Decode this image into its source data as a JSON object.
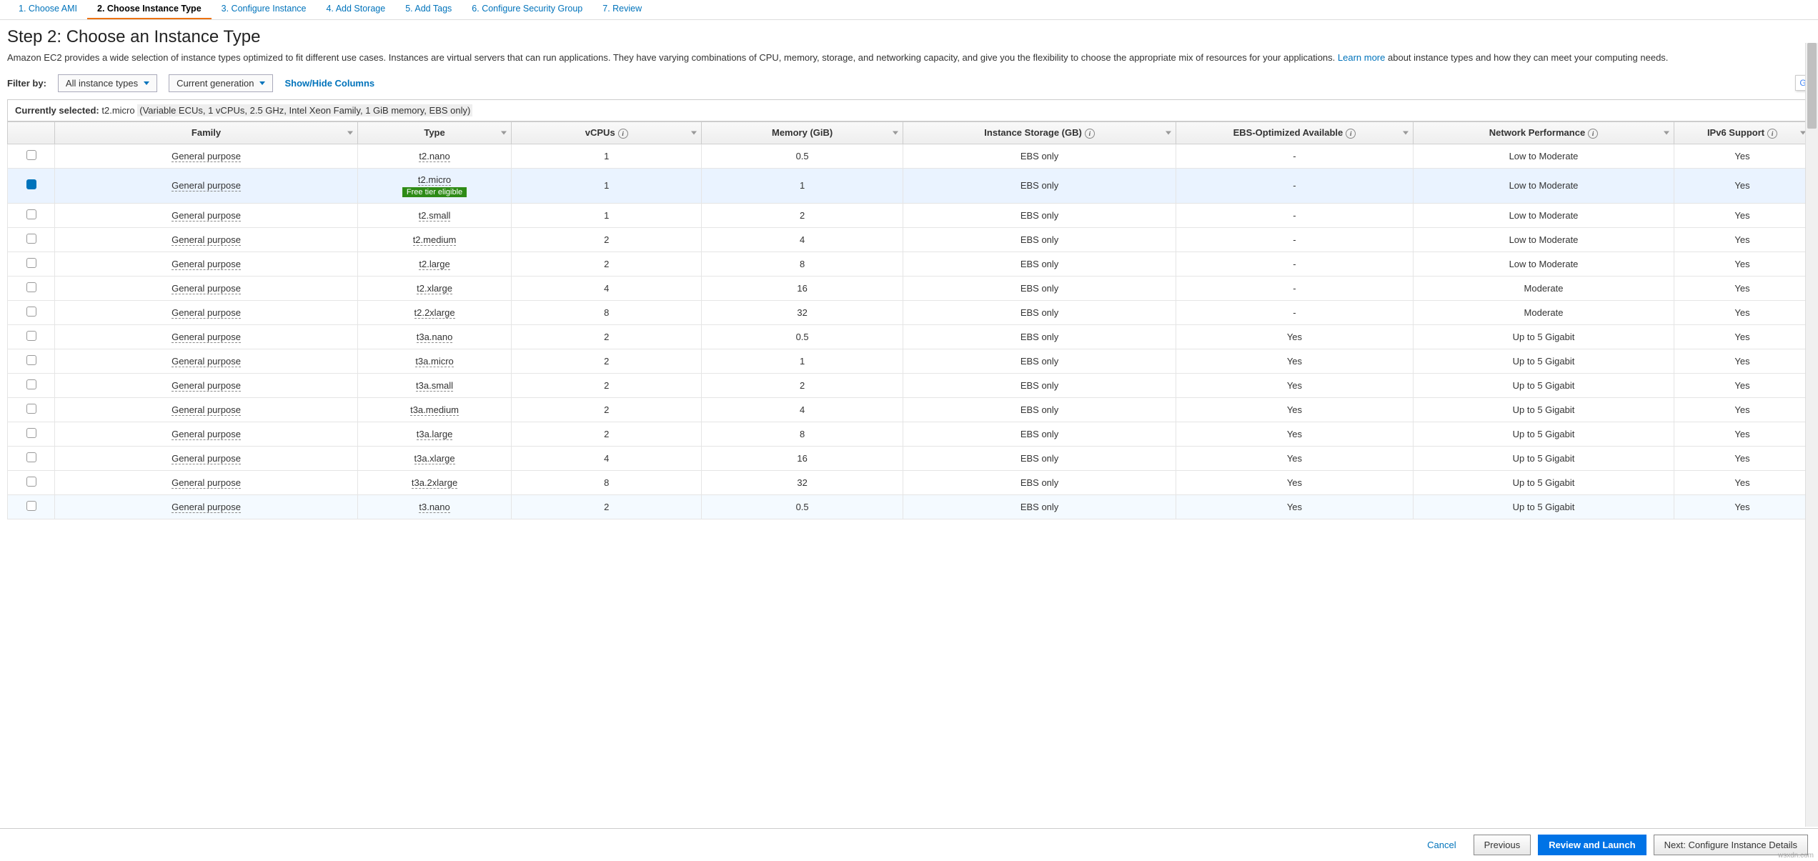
{
  "wizard_tabs": [
    {
      "label": "1. Choose AMI",
      "active": false
    },
    {
      "label": "2. Choose Instance Type",
      "active": true
    },
    {
      "label": "3. Configure Instance",
      "active": false
    },
    {
      "label": "4. Add Storage",
      "active": false
    },
    {
      "label": "5. Add Tags",
      "active": false
    },
    {
      "label": "6. Configure Security Group",
      "active": false
    },
    {
      "label": "7. Review",
      "active": false
    }
  ],
  "heading": "Step 2: Choose an Instance Type",
  "description_pre": "Amazon EC2 provides a wide selection of instance types optimized to fit different use cases. Instances are virtual servers that can run applications. They have varying combinations of CPU, memory, storage, and networking capacity, and give you the flexibility to choose the appropriate mix of resources for your applications.",
  "learn_more_label": "Learn more",
  "description_post": "about instance types and how they can meet your computing needs.",
  "filter": {
    "label": "Filter by:",
    "all_types_label": "All instance types",
    "generation_label": "Current generation",
    "show_hide_label": "Show/Hide Columns"
  },
  "currently_selected": {
    "label": "Currently selected:",
    "value": "t2.micro",
    "details": "(Variable ECUs, 1 vCPUs, 2.5 GHz, Intel Xeon Family, 1 GiB memory, EBS only)"
  },
  "columns": {
    "family": "Family",
    "type": "Type",
    "vcpus": "vCPUs",
    "memory": "Memory (GiB)",
    "storage": "Instance Storage (GB)",
    "ebs": "EBS-Optimized Available",
    "network": "Network Performance",
    "ipv6": "IPv6 Support"
  },
  "free_tier_label": "Free tier eligible",
  "rows": [
    {
      "selected": false,
      "family": "General purpose",
      "type": "t2.nano",
      "free": false,
      "vcpus": "1",
      "memory": "0.5",
      "storage": "EBS only",
      "ebs": "-",
      "network": "Low to Moderate",
      "ipv6": "Yes"
    },
    {
      "selected": true,
      "family": "General purpose",
      "type": "t2.micro",
      "free": true,
      "vcpus": "1",
      "memory": "1",
      "storage": "EBS only",
      "ebs": "-",
      "network": "Low to Moderate",
      "ipv6": "Yes"
    },
    {
      "selected": false,
      "family": "General purpose",
      "type": "t2.small",
      "free": false,
      "vcpus": "1",
      "memory": "2",
      "storage": "EBS only",
      "ebs": "-",
      "network": "Low to Moderate",
      "ipv6": "Yes"
    },
    {
      "selected": false,
      "family": "General purpose",
      "type": "t2.medium",
      "free": false,
      "vcpus": "2",
      "memory": "4",
      "storage": "EBS only",
      "ebs": "-",
      "network": "Low to Moderate",
      "ipv6": "Yes"
    },
    {
      "selected": false,
      "family": "General purpose",
      "type": "t2.large",
      "free": false,
      "vcpus": "2",
      "memory": "8",
      "storage": "EBS only",
      "ebs": "-",
      "network": "Low to Moderate",
      "ipv6": "Yes"
    },
    {
      "selected": false,
      "family": "General purpose",
      "type": "t2.xlarge",
      "free": false,
      "vcpus": "4",
      "memory": "16",
      "storage": "EBS only",
      "ebs": "-",
      "network": "Moderate",
      "ipv6": "Yes"
    },
    {
      "selected": false,
      "family": "General purpose",
      "type": "t2.2xlarge",
      "free": false,
      "vcpus": "8",
      "memory": "32",
      "storage": "EBS only",
      "ebs": "-",
      "network": "Moderate",
      "ipv6": "Yes"
    },
    {
      "selected": false,
      "family": "General purpose",
      "type": "t3a.nano",
      "free": false,
      "vcpus": "2",
      "memory": "0.5",
      "storage": "EBS only",
      "ebs": "Yes",
      "network": "Up to 5 Gigabit",
      "ipv6": "Yes"
    },
    {
      "selected": false,
      "family": "General purpose",
      "type": "t3a.micro",
      "free": false,
      "vcpus": "2",
      "memory": "1",
      "storage": "EBS only",
      "ebs": "Yes",
      "network": "Up to 5 Gigabit",
      "ipv6": "Yes"
    },
    {
      "selected": false,
      "family": "General purpose",
      "type": "t3a.small",
      "free": false,
      "vcpus": "2",
      "memory": "2",
      "storage": "EBS only",
      "ebs": "Yes",
      "network": "Up to 5 Gigabit",
      "ipv6": "Yes"
    },
    {
      "selected": false,
      "family": "General purpose",
      "type": "t3a.medium",
      "free": false,
      "vcpus": "2",
      "memory": "4",
      "storage": "EBS only",
      "ebs": "Yes",
      "network": "Up to 5 Gigabit",
      "ipv6": "Yes"
    },
    {
      "selected": false,
      "family": "General purpose",
      "type": "t3a.large",
      "free": false,
      "vcpus": "2",
      "memory": "8",
      "storage": "EBS only",
      "ebs": "Yes",
      "network": "Up to 5 Gigabit",
      "ipv6": "Yes"
    },
    {
      "selected": false,
      "family": "General purpose",
      "type": "t3a.xlarge",
      "free": false,
      "vcpus": "4",
      "memory": "16",
      "storage": "EBS only",
      "ebs": "Yes",
      "network": "Up to 5 Gigabit",
      "ipv6": "Yes"
    },
    {
      "selected": false,
      "family": "General purpose",
      "type": "t3a.2xlarge",
      "free": false,
      "vcpus": "8",
      "memory": "32",
      "storage": "EBS only",
      "ebs": "Yes",
      "network": "Up to 5 Gigabit",
      "ipv6": "Yes"
    },
    {
      "selected": false,
      "hover": true,
      "family": "General purpose",
      "type": "t3.nano",
      "free": false,
      "vcpus": "2",
      "memory": "0.5",
      "storage": "EBS only",
      "ebs": "Yes",
      "network": "Up to 5 Gigabit",
      "ipv6": "Yes"
    }
  ],
  "footer": {
    "cancel": "Cancel",
    "previous": "Previous",
    "review": "Review and Launch",
    "next": "Next: Configure Instance Details"
  },
  "watermark": "wsxdn.com"
}
